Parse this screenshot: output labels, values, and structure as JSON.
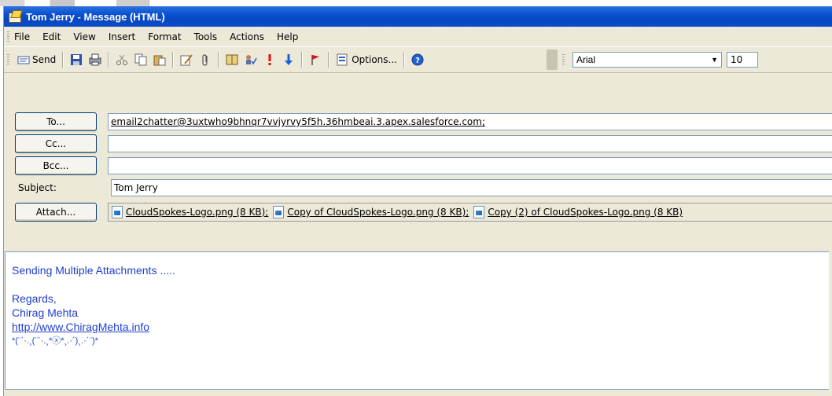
{
  "window": {
    "title": "Tom Jerry - Message (HTML)"
  },
  "menu": [
    "File",
    "Edit",
    "View",
    "Insert",
    "Format",
    "Tools",
    "Actions",
    "Help"
  ],
  "toolbar": {
    "send_label": "Send",
    "options_label": "Options...",
    "font": "Arial",
    "size": "10"
  },
  "fields": {
    "to_label": "To...",
    "to_value": "email2chatter@3uxtwho9bhnqr7vvjyrvy5f5h.36hmbeai.3.apex.salesforce.com;",
    "cc_label": "Cc...",
    "cc_value": "",
    "bcc_label": "Bcc...",
    "bcc_value": "",
    "subject_label": "Subject:",
    "subject_value": "Tom Jerry",
    "attach_label": "Attach...",
    "attachments": [
      "CloudSpokes-Logo.png (8 KB);",
      "Copy of CloudSpokes-Logo.png (8 KB);",
      "Copy (2) of CloudSpokes-Logo.png (8 KB)"
    ]
  },
  "body": {
    "line1": "Sending Multiple Attachments .....",
    "line2": "Regards,",
    "line3": "Chirag Mehta",
    "link": "http://www.ChiragMehta.info",
    "line5": "*(¨`·.¸(¨`·.¸*ⓧ*¸.·´)¸.·´¨)*"
  },
  "colors": {
    "titlebar": "#0a4fd0",
    "chrome": "#ece9d8",
    "body_text": "#1f3fd0"
  }
}
